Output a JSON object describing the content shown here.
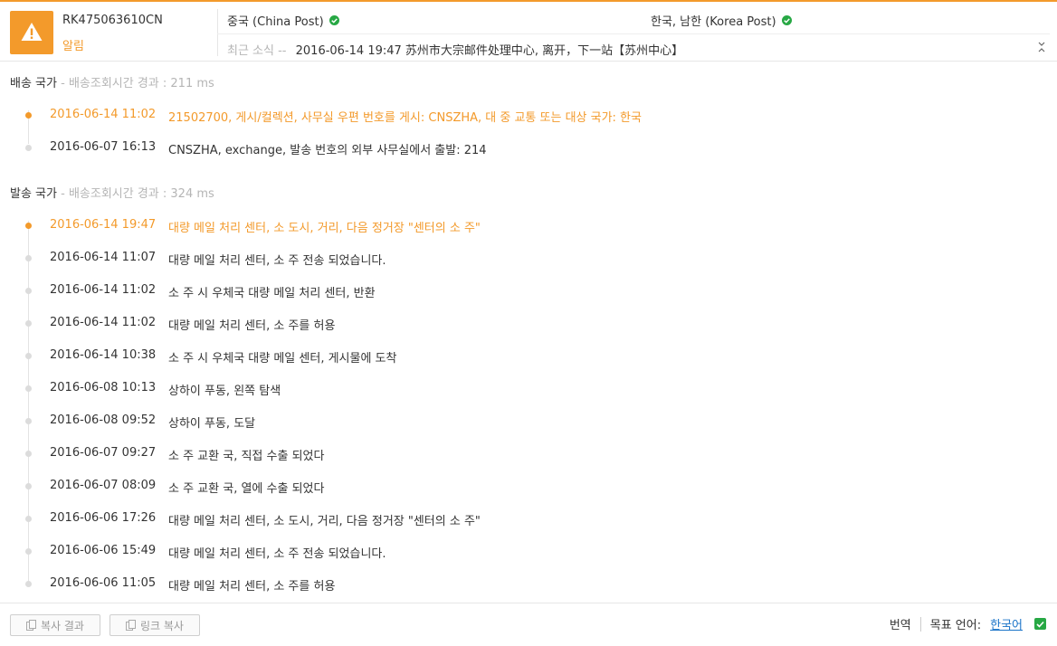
{
  "header": {
    "tracking_number": "RK475063610CN",
    "status": "알림",
    "origin_carrier": "중국 (China Post)",
    "destination_carrier": "한국, 남한 (Korea Post)",
    "latest_label": "최근 소식 --",
    "latest_text": "2016-06-14 19:47 苏州市大宗邮件处理中心, 离开，下一站【苏州中心】"
  },
  "destination_section": {
    "title": "배송 국가",
    "timing": "- 배송조회시간 경과 : 211 ms",
    "events": [
      {
        "date": "2016-06-14 11:02",
        "desc": "21502700, 게시/컬렉션, 사무실 우편 번호를 게시: CNSZHA, 대 중 교통 또는 대상 국가: 한국"
      },
      {
        "date": "2016-06-07 16:13",
        "desc": "CNSZHA, exchange, 발송 번호의 외부 사무실에서 출발: 214"
      }
    ]
  },
  "origin_section": {
    "title": "발송 국가",
    "timing": "- 배송조회시간 경과 : 324 ms",
    "events": [
      {
        "date": "2016-06-14 19:47",
        "desc": "대량 메일 처리 센터, 소 도시, 거리, 다음 정거장 \"센터의 소 주\""
      },
      {
        "date": "2016-06-14 11:07",
        "desc": "대량 메일 처리 센터, 소 주 전송 되었습니다."
      },
      {
        "date": "2016-06-14 11:02",
        "desc": "소 주 시 우체국 대량 메일 처리 센터, 반환"
      },
      {
        "date": "2016-06-14 11:02",
        "desc": "대량 메일 처리 센터, 소 주를 허용"
      },
      {
        "date": "2016-06-14 10:38",
        "desc": "소 주 시 우체국 대량 메일 센터, 게시물에 도착"
      },
      {
        "date": "2016-06-08 10:13",
        "desc": "상하이 푸동, 왼쪽 탐색"
      },
      {
        "date": "2016-06-08 09:52",
        "desc": "상하이 푸동, 도달"
      },
      {
        "date": "2016-06-07 09:27",
        "desc": "소 주 교환 국, 직접 수출 되었다"
      },
      {
        "date": "2016-06-07 08:09",
        "desc": "소 주 교환 국, 열에 수출 되었다"
      },
      {
        "date": "2016-06-06 17:26",
        "desc": "대량 메일 처리 센터, 소 도시, 거리, 다음 정거장 \"센터의 소 주\""
      },
      {
        "date": "2016-06-06 15:49",
        "desc": "대량 메일 처리 센터, 소 주 전송 되었습니다."
      },
      {
        "date": "2016-06-06 11:05",
        "desc": "대량 메일 처리 센터, 소 주를 허용"
      }
    ]
  },
  "footer": {
    "copy_result": "복사 결과",
    "copy_link": "링크 복사",
    "translate": "번역",
    "target_language_label": "목표 언어:",
    "target_language": "한국어"
  },
  "colors": {
    "accent": "#f39a2b",
    "ok": "#27a844",
    "link": "#1a73c8"
  }
}
